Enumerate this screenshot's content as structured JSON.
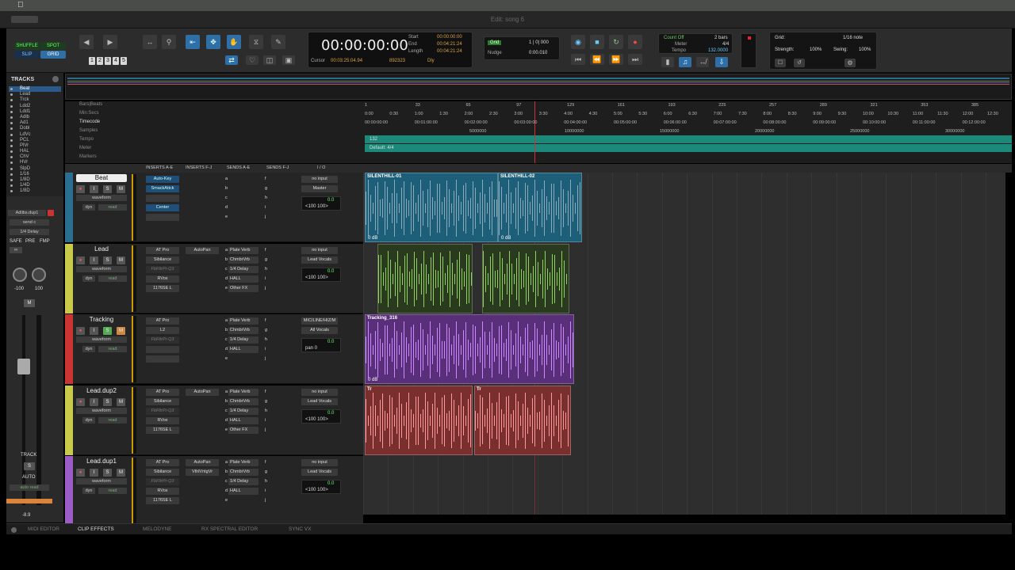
{
  "window": {
    "title": "Edit: song 6"
  },
  "toolbar": {
    "modes": [
      "SHUFFLE",
      "SPOT",
      "SLIP",
      "GRID"
    ],
    "nums": [
      "1",
      "2",
      "3",
      "4",
      "5"
    ],
    "counter": {
      "main": "00:00:00:00",
      "start_l": "Start",
      "end_l": "End",
      "length_l": "Length",
      "start": "00:00:00:00",
      "end": "00:04:21:24",
      "length": "00:04:21:24",
      "cursor_l": "Cursor",
      "cursor": "00:03:25:04.94",
      "samples": "892323",
      "dly": "Dly"
    },
    "grid": {
      "label": "Grid",
      "value": "1 | 0| 000",
      "nudge_l": "Nudge",
      "nudge": "0:00.010"
    },
    "transport": {
      "count": "Count Off",
      "bars": "2 bars",
      "meter_l": "Meter",
      "meter": "4/4",
      "tempo_l": "Tempo",
      "tempo": "132.0000"
    },
    "quantize": {
      "grid_l": "Grid:",
      "grid": "1/16 note",
      "strength_l": "Strength:",
      "strength": "100%",
      "swing_l": "Swing:",
      "swing": "100%"
    }
  },
  "tracks_panel": {
    "title": "TRACKS",
    "items": [
      "Beat",
      "Lead",
      "Trck",
      "Ldd2",
      "Ldd1",
      "Adlb",
      "Ad1",
      "Dobl",
      "LdVc",
      "PCL",
      "PlVr",
      "HAL",
      "ChV",
      "HVr",
      "SlpD",
      "1/16",
      "1/8D",
      "1/4D",
      "1/8D"
    ]
  },
  "left_strip": {
    "insert": "Adlibs.dup1",
    "send": "send c",
    "delay": "1/4 Delay",
    "safe": "SAFE",
    "pre": "PRE",
    "fmp": "FMP",
    "pan_l": "-100",
    "pan_r": "100",
    "mute": "M",
    "vol": "-8.9",
    "track": "TRACK",
    "solo": "S",
    "auto": "AUTO",
    "autoread": "auto read"
  },
  "ruler": {
    "rows": [
      "Bars|Beats",
      "Min:Secs",
      "Timecode",
      "Samples",
      "Tempo",
      "Meter",
      "Markers"
    ],
    "bars": [
      "1",
      "33",
      "65",
      "97",
      "129",
      "161",
      "193",
      "225",
      "257",
      "289",
      "321",
      "353",
      "385"
    ],
    "mins": [
      "0:00",
      "0:30",
      "1:00",
      "1:30",
      "2:00",
      "2:30",
      "3:00",
      "3:30",
      "4:00",
      "4:30",
      "5:00",
      "5:30",
      "6:00",
      "6:30",
      "7:00",
      "7:30",
      "8:00",
      "8:30",
      "9:00",
      "9:30",
      "10:00",
      "10:30",
      "11:00",
      "11:30",
      "12:00",
      "12:30"
    ],
    "timecode": [
      "00:00:00:00",
      "00:01:00:00",
      "00:02:00:00",
      "00:03:00:00",
      "00:04:00:00",
      "00:05:00:00",
      "00:06:00:00",
      "00:07:00:00",
      "00:08:00:00",
      "00:09:00:00",
      "00:10:00:00",
      "00:11:00:00",
      "00:12:00:00"
    ],
    "samples": [
      "5000000",
      "10000000",
      "15000000",
      "20000000",
      "25000000",
      "30000000"
    ],
    "tempo_val": "132",
    "meter_val": "Default: 4/4"
  },
  "columns": [
    "INSERTS A-E",
    "INSERTS F-J",
    "SENDS A-E",
    "SENDS F-J",
    "I / O"
  ],
  "tracks": [
    {
      "name": "Beat",
      "view": "waveform",
      "dyn": "dyn",
      "read": "read",
      "inserts": [
        "Auto-Key",
        "SmackAttck",
        "",
        "Center",
        ""
      ],
      "insf": [],
      "sends": [],
      "input": "no input",
      "output": "Master",
      "vol": "0.0",
      "pan": "<100  100>",
      "clips": [
        {
          "name": "SILENTHILL-01",
          "db": "0 dB"
        },
        {
          "name": "SILENTHILL-02",
          "db": "0 dB"
        }
      ]
    },
    {
      "name": "Lead",
      "view": "waveform",
      "dyn": "dyn",
      "read": "read",
      "inserts": [
        "AT Pro",
        "Sibilance",
        "FbFltrPr-Q3",
        "RVox",
        "1176SE L"
      ],
      "insf": [
        "AutoPan"
      ],
      "sends": [
        "Plate Verb",
        "ChmbrVrb",
        "1/4 Delay",
        "HALL",
        "Other FX"
      ],
      "input": "no input",
      "output": "Lead Vocals",
      "vol": "0.0",
      "pan": "<100  100>",
      "clips": []
    },
    {
      "name": "Tracking",
      "view": "waveform",
      "dyn": "dyn",
      "read": "read",
      "inserts": [
        "AT Pro",
        "L2",
        "FbFltrPr-Q3",
        "",
        ""
      ],
      "insf": [],
      "sends": [
        "Plate Verb",
        "ChmbrVrb",
        "1/4 Delay",
        "HALL",
        ""
      ],
      "input": "MIC/LINE/HIZ/M",
      "output": "All Vocals",
      "vol": "0.0",
      "pan": "pan  0",
      "clips": [
        {
          "name": "Tracking_316",
          "db": "0 dB"
        }
      ]
    },
    {
      "name": "Lead.dup2",
      "view": "waveform",
      "dyn": "dyn",
      "read": "read",
      "inserts": [
        "AT Pro",
        "Sibilance",
        "FbFltrPr-Q3",
        "RVox",
        "1176SE L"
      ],
      "insf": [
        "AutoPan"
      ],
      "sends": [
        "Plate Verb",
        "ChmbrVrb",
        "1/4 Delay",
        "HALL",
        "Other FX"
      ],
      "input": "no input",
      "output": "Lead Vocals",
      "vol": "0.0",
      "pan": "<100  100>",
      "clips": [
        {
          "name": "Tr",
          "db": ""
        },
        {
          "name": "Tr",
          "db": ""
        }
      ]
    },
    {
      "name": "Lead.dup1",
      "view": "waveform",
      "dyn": "dyn",
      "read": "read",
      "inserts": [
        "AT Pro",
        "Sibilance",
        "FbFltrPr-Q3",
        "RVox",
        "1176SE L"
      ],
      "insf": [
        "AutoPan",
        "VthlVntgVr"
      ],
      "sends": [
        "Plate Verb",
        "ChmbrVrb",
        "1/4 Delay",
        "HALL",
        ""
      ],
      "input": "no input",
      "output": "Lead Vocals",
      "vol": "0.0",
      "pan": "<100  100>",
      "clips": []
    }
  ],
  "bottom_tabs": [
    "MIDI EDITOR",
    "CLIP EFFECTS",
    "MELODYNE",
    "RX SPECTRAL EDITOR",
    "SYNC VX"
  ],
  "colors": {
    "beat": "#1d6d8d",
    "lead": "#7ec850",
    "tracking": "#8a4bb5",
    "leaddup2": "#d06a6a",
    "leaddup1": "#9b5cc8"
  }
}
